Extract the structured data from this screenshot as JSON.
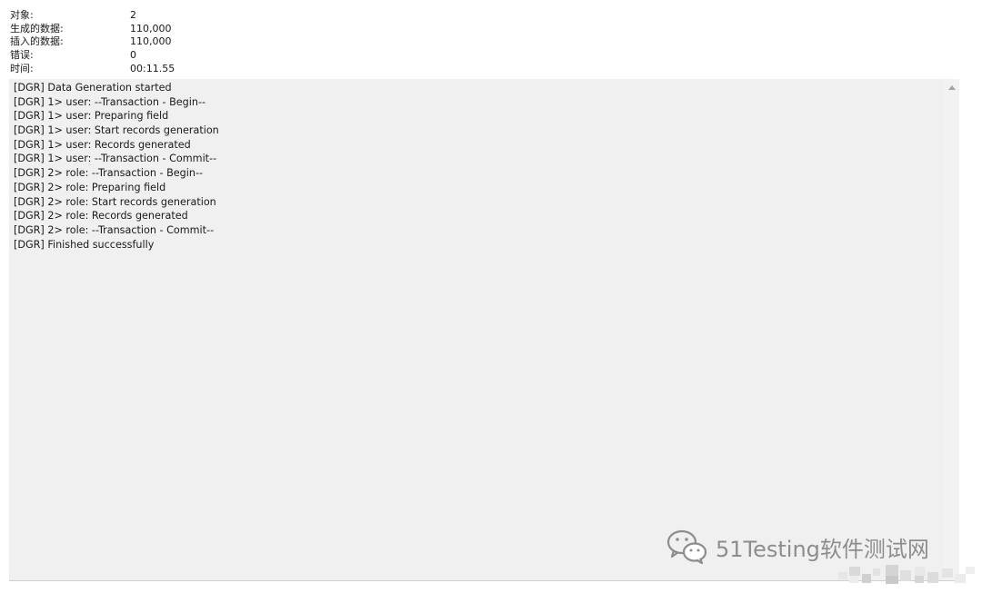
{
  "summary": {
    "rows": [
      {
        "label": "对象:",
        "value": "2"
      },
      {
        "label": "生成的数据:",
        "value": "110,000"
      },
      {
        "label": "插入的数据:",
        "value": "110,000"
      },
      {
        "label": "错误:",
        "value": "0"
      },
      {
        "label": "时间:",
        "value": "00:11.55"
      }
    ]
  },
  "log": {
    "lines": [
      "[DGR] Data Generation started",
      "[DGR] 1> user: --Transaction - Begin--",
      "[DGR] 1> user: Preparing field",
      "[DGR] 1> user: Start records generation",
      "[DGR] 1> user: Records generated",
      "[DGR] 1> user: --Transaction - Commit--",
      "[DGR] 2> role: --Transaction - Begin--",
      "[DGR] 2> role: Preparing field",
      "[DGR] 2> role: Start records generation",
      "[DGR] 2> role: Records generated",
      "[DGR] 2> role: --Transaction - Commit--",
      "[DGR] Finished successfully"
    ]
  },
  "watermark": {
    "text": "51Testing软件测试网",
    "icon": "wechat-icon"
  },
  "colors": {
    "panel_bg": "#f0f0f0",
    "watermark": "#8d8d8d"
  }
}
